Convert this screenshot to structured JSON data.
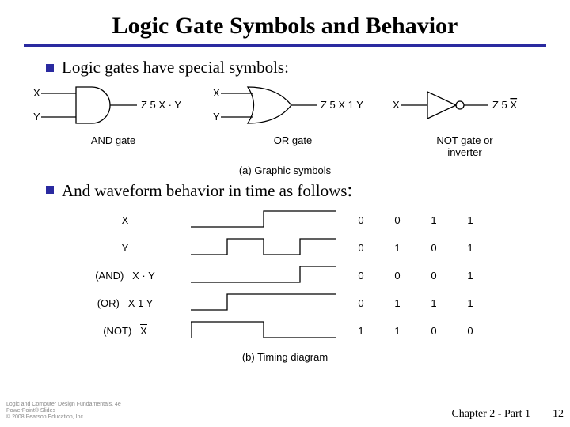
{
  "title": "Logic Gate Symbols and Behavior",
  "bullets": {
    "b1": "Logic gates have special symbols:",
    "b2_pre": "And waveform behavior in time as follows",
    "b2_colon": ":"
  },
  "gates": {
    "and": {
      "inA": "X",
      "inB": "Y",
      "out": "Z 5 X · Y",
      "label": "AND gate"
    },
    "or": {
      "inA": "X",
      "inB": "Y",
      "out": "Z 5 X 1 Y",
      "label": "OR gate"
    },
    "not": {
      "in": "X",
      "out_prefix": "Z 5 ",
      "out_var": "X",
      "label": "NOT gate or",
      "label2": "inverter"
    }
  },
  "captions": {
    "a": "(a) Graphic symbols",
    "b": "(b) Timing diagram"
  },
  "timing": {
    "rows": [
      {
        "name": "X",
        "vals": [
          "0",
          "0",
          "1",
          "1"
        ],
        "wave": [
          0,
          0,
          1,
          1
        ]
      },
      {
        "name": "Y",
        "vals": [
          "0",
          "1",
          "0",
          "1"
        ],
        "wave": [
          0,
          1,
          0,
          1
        ]
      },
      {
        "name": "(AND)  X · Y",
        "vals": [
          "0",
          "0",
          "0",
          "1"
        ],
        "wave": [
          0,
          0,
          0,
          1
        ]
      },
      {
        "name": "(OR)  X 1 Y",
        "vals": [
          "0",
          "1",
          "1",
          "1"
        ],
        "wave": [
          0,
          1,
          1,
          1
        ]
      },
      {
        "name": "(NOT)  X̄",
        "vals": [
          "1",
          "1",
          "0",
          "0"
        ],
        "wave": [
          1,
          1,
          0,
          0
        ]
      }
    ],
    "labels_html": {
      "r0": "X",
      "r1": "Y",
      "r2": "(AND)&nbsp;&nbsp;&nbsp;X · Y",
      "r3": "(OR)&nbsp;&nbsp;&nbsp;X 1 Y",
      "r4": "(NOT)&nbsp;&nbsp;&nbsp;<span class=\"xbar\">X</span>"
    }
  },
  "footer": {
    "line1": "Logic and Computer Design Fundamentals, 4e",
    "line2": "PowerPoint® Slides",
    "line3": "© 2008 Pearson Education, Inc.",
    "chapter": "Chapter 2 - Part 1",
    "page": "12"
  },
  "chart_data": {
    "type": "table",
    "title": "Logic gate timing diagram truth table",
    "columns": [
      "X",
      "Y",
      "X·Y (AND)",
      "X+Y (OR)",
      "X' (NOT)"
    ],
    "rows": [
      [
        0,
        0,
        0,
        0,
        1
      ],
      [
        0,
        1,
        0,
        1,
        1
      ],
      [
        1,
        0,
        0,
        1,
        0
      ],
      [
        1,
        1,
        1,
        1,
        0
      ]
    ]
  }
}
